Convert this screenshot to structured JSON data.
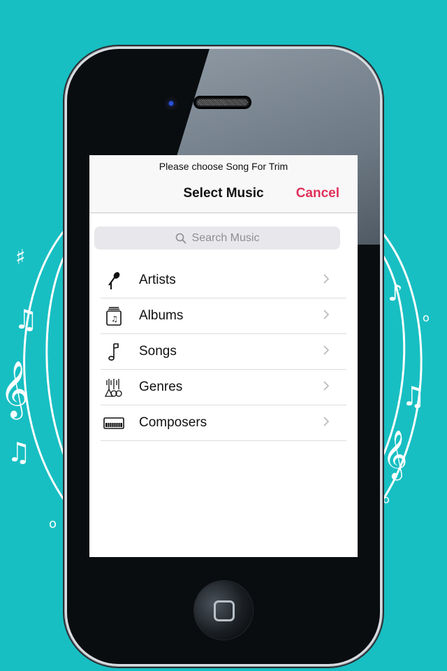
{
  "background": {
    "color": "#17bfc2",
    "decoration": "white music notes in circular arcs"
  },
  "device": {
    "model": "iPhone 4-style frame"
  },
  "app": {
    "header": {
      "subtitle": "Please choose Song For Trim",
      "title": "Select Music",
      "cancel_label": "Cancel",
      "accent_color": "#e0305a"
    },
    "search": {
      "placeholder": "Search Music",
      "icon": "search-icon"
    },
    "list": {
      "items": [
        {
          "label": "Artists",
          "icon": "microphone-icon"
        },
        {
          "label": "Albums",
          "icon": "album-stack-icon"
        },
        {
          "label": "Songs",
          "icon": "music-note-icon"
        },
        {
          "label": "Genres",
          "icon": "guitars-icon"
        },
        {
          "label": "Composers",
          "icon": "piano-keyboard-icon"
        }
      ]
    }
  }
}
